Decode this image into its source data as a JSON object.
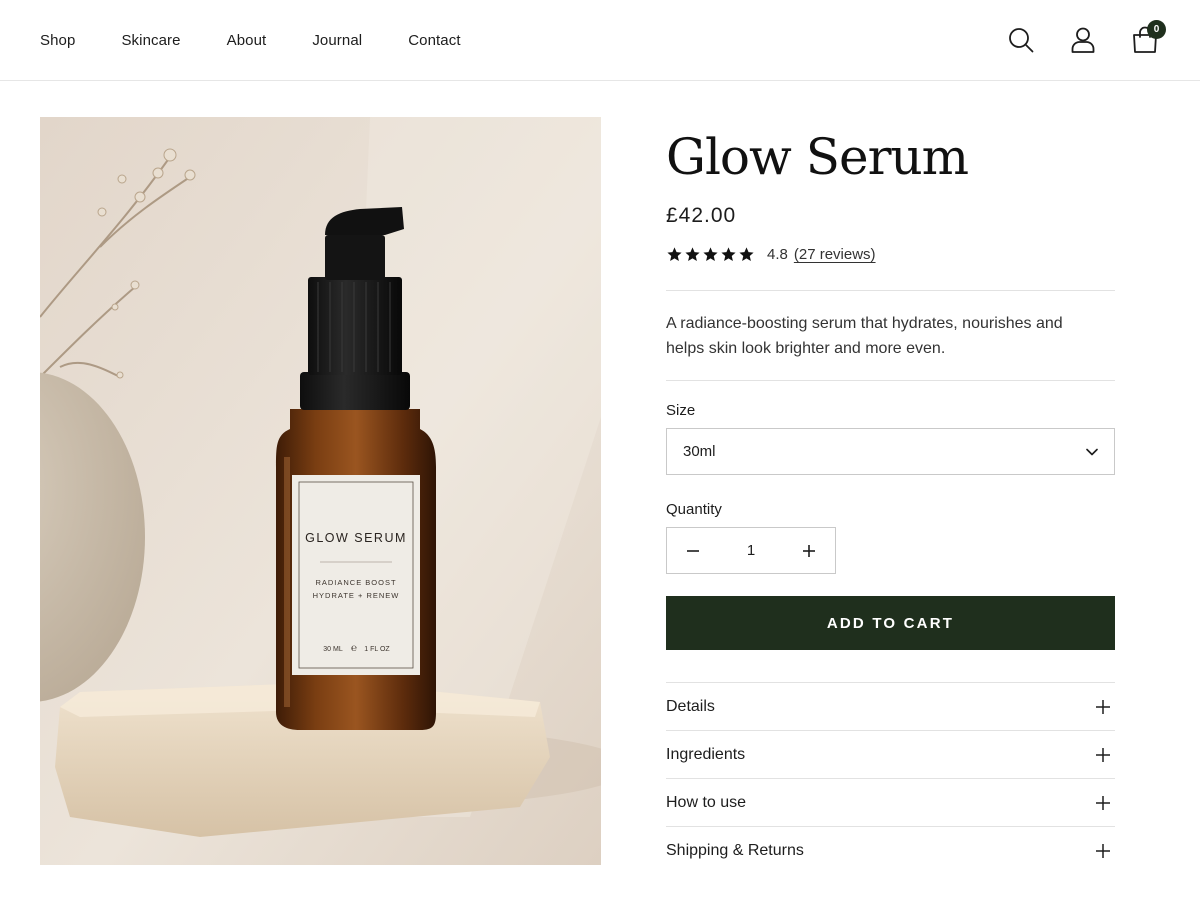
{
  "nav": {
    "items": [
      "Shop",
      "Skincare",
      "About",
      "Journal",
      "Contact"
    ]
  },
  "header_icons": {
    "search": "search-icon",
    "account": "user-icon",
    "cart": "bag-icon",
    "cart_count": "0"
  },
  "product": {
    "title": "Glow Serum",
    "price": "£42.00",
    "rating": 4.8,
    "rating_label": "4.8",
    "stars_filled": 5,
    "reviews_label": "(27 reviews)",
    "description": "A radiance-boosting serum that hydrates, nourishes and helps skin look brighter and more even.",
    "image_label": {
      "name": "GLOW SERUM",
      "line1": "RADIANCE BOOST",
      "line2": "HYDRATE + RENEW",
      "volume": "30 ML",
      "volume_fl": "1 FL OZ"
    }
  },
  "size": {
    "label": "Size",
    "selected": "30ml"
  },
  "quantity": {
    "label": "Quantity",
    "value": "1"
  },
  "add_to_cart_label": "ADD TO CART",
  "accordion": [
    "Details",
    "Ingredients",
    "How to use",
    "Shipping & Returns"
  ],
  "colors": {
    "accent": "#1f2f1d",
    "bottle": "#6a3410",
    "background": "#e8ddd2"
  }
}
